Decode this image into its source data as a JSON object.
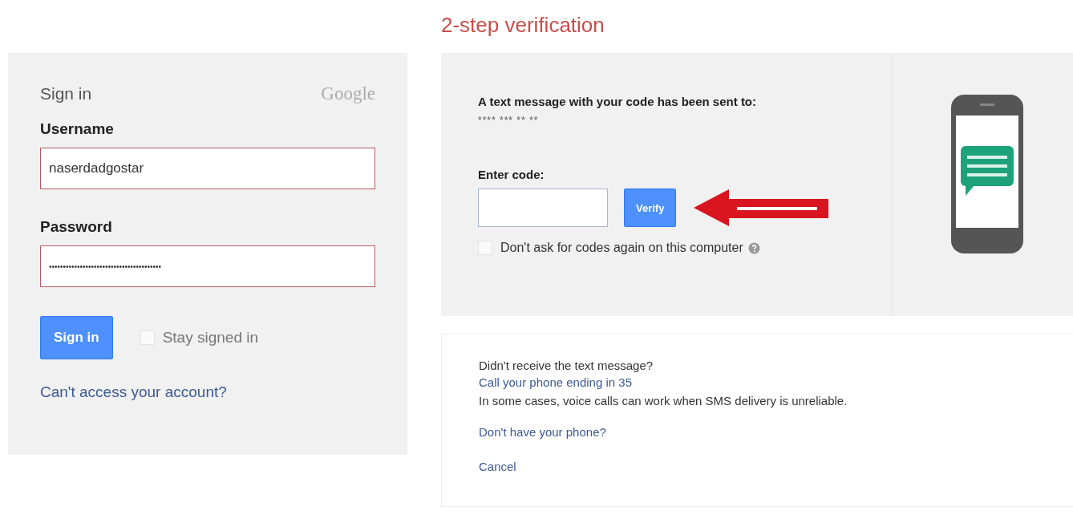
{
  "heading": "2-step verification",
  "sign_in": {
    "title": "Sign in",
    "brand": "Google",
    "username": {
      "label": "Username",
      "value": "naserdadgostar"
    },
    "password": {
      "label": "Password",
      "value": "••••••••••••••••••••••••••••••••••••••••"
    },
    "button": "Sign in",
    "stay_signed_in": {
      "label": "Stay signed in",
      "checked": false
    },
    "help_link": "Can't access your account?"
  },
  "verification": {
    "message": "A text message with your code has been sent to:",
    "masked_number": "**** *** ** **",
    "code_label": "Enter code:",
    "verify_button": "Verify",
    "remember": {
      "label": "Don't ask for codes again on this computer",
      "checked": false
    }
  },
  "alternatives": {
    "question": "Didn't receive the text message?",
    "call_link": "Call your phone ending in 35",
    "note": "In some cases, voice calls can work when SMS delivery is unreliable.",
    "no_phone_link": "Don't have your phone?",
    "cancel_link": "Cancel"
  }
}
